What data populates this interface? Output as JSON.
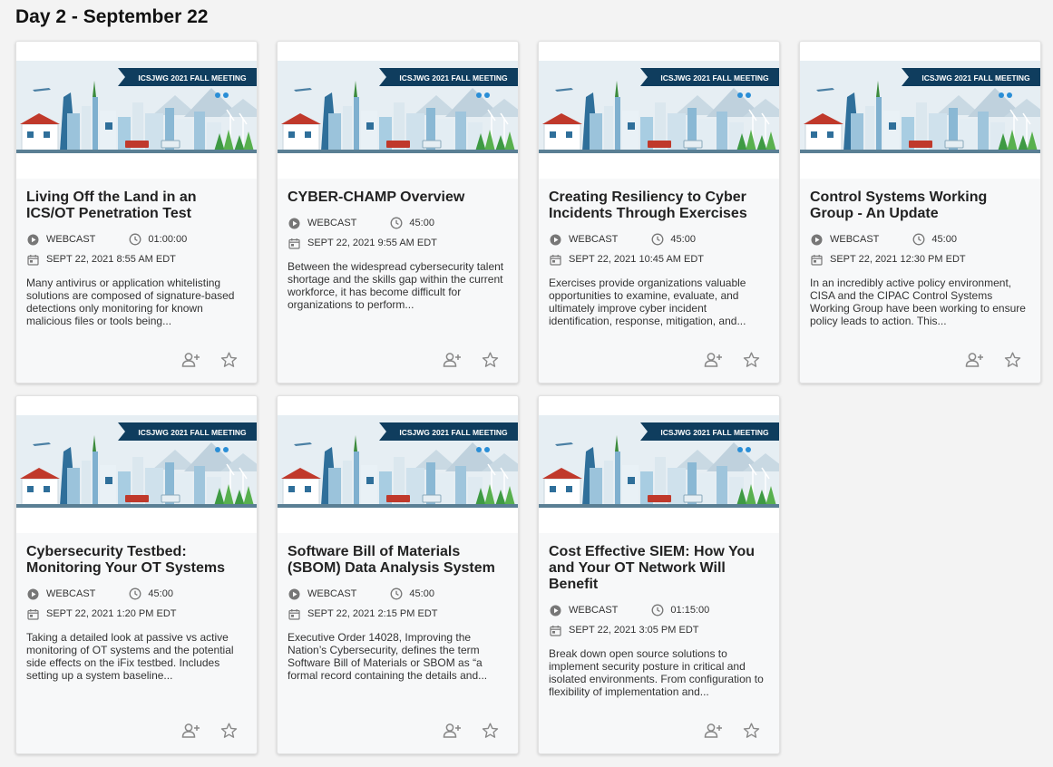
{
  "page": {
    "day_title": "Day 2 - September 22"
  },
  "banner": {
    "text": "ICSJWG 2021 FALL MEETING"
  },
  "icons": {
    "format": "play-circle-icon",
    "duration": "clock-icon",
    "date": "calendar-icon",
    "register": "add-person-icon",
    "favorite": "star-outline-icon"
  },
  "colors": {
    "accent_banner": "#0f3d5e",
    "icon_gray": "#777777"
  },
  "sessions": [
    {
      "title": "Living Off the Land in an ICS/OT Penetration Test",
      "format": "WEBCAST",
      "duration": "01:00:00",
      "datetime": "SEPT 22, 2021 8:55 AM EDT",
      "description": "Many antivirus or application whitelisting solutions are composed of signature-based detections only monitoring for known malicious files or tools being..."
    },
    {
      "title": "CYBER-CHAMP Overview",
      "format": "WEBCAST",
      "duration": "45:00",
      "datetime": "SEPT 22, 2021 9:55 AM EDT",
      "description": "Between the widespread cybersecurity talent shortage and the skills gap within the current workforce, it has become difficult for organizations to perform..."
    },
    {
      "title": "Creating Resiliency to Cyber Incidents Through Exercises",
      "format": "WEBCAST",
      "duration": "45:00",
      "datetime": "SEPT 22, 2021 10:45 AM EDT",
      "description": "Exercises provide organizations valuable opportunities to examine, evaluate, and ultimately improve cyber incident identification, response, mitigation, and..."
    },
    {
      "title": "Control Systems Working Group - An Update",
      "format": "WEBCAST",
      "duration": "45:00",
      "datetime": "SEPT 22, 2021 12:30 PM EDT",
      "description": "In an incredibly active policy environment, CISA and the CIPAC Control Systems Working Group have been working to ensure policy leads to action.  This..."
    },
    {
      "title": "Cybersecurity Testbed: Monitoring Your OT Systems",
      "format": "WEBCAST",
      "duration": "45:00",
      "datetime": "SEPT 22, 2021 1:20 PM EDT",
      "description": "Taking a detailed look at passive vs active monitoring of OT systems and the potential side effects on the iFix testbed. Includes setting up a system baseline..."
    },
    {
      "title": "Software Bill of Materials (SBOM) Data Analysis System",
      "format": "WEBCAST",
      "duration": "45:00",
      "datetime": "SEPT 22, 2021 2:15 PM EDT",
      "description": "Executive Order 14028, Improving the Nation’s Cybersecurity, defines the term Software Bill of Materials or SBOM as “a formal record containing the details and..."
    },
    {
      "title": "Cost Effective SIEM: How You and Your OT Network Will Benefit",
      "format": "WEBCAST",
      "duration": "01:15:00",
      "datetime": "SEPT 22, 2021 3:05 PM EDT",
      "description": "Break down open source solutions to implement security posture in critical and isolated environments. From configuration to flexibility of implementation and..."
    }
  ]
}
